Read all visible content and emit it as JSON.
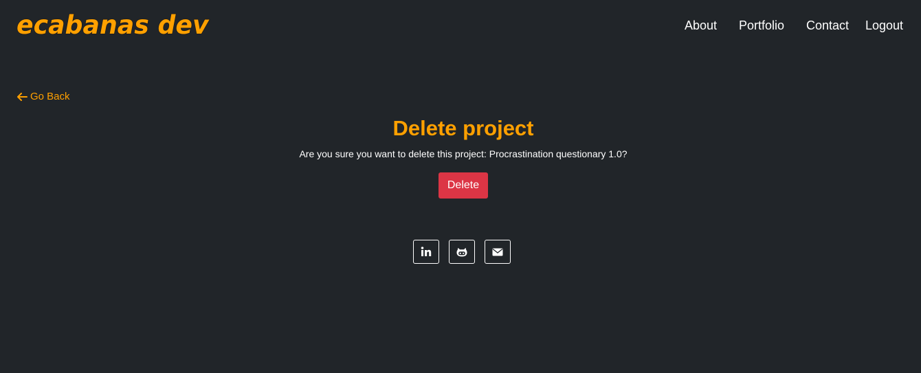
{
  "brand": "ecabanas dev",
  "nav": {
    "items": [
      "About",
      "Portfolio",
      "Contact",
      "Logout"
    ]
  },
  "back_link": "Go Back",
  "page": {
    "title": "Delete project",
    "confirm_text": "Are you sure you want to delete this project: Procrastination questionary 1.0?",
    "delete_label": "Delete"
  },
  "social": {
    "icons": [
      "linkedin-icon",
      "github-icon",
      "envelope-icon"
    ]
  },
  "colors": {
    "background": "#212529",
    "accent": "#ffa000",
    "danger": "#dc3545",
    "text": "#ffffff"
  }
}
